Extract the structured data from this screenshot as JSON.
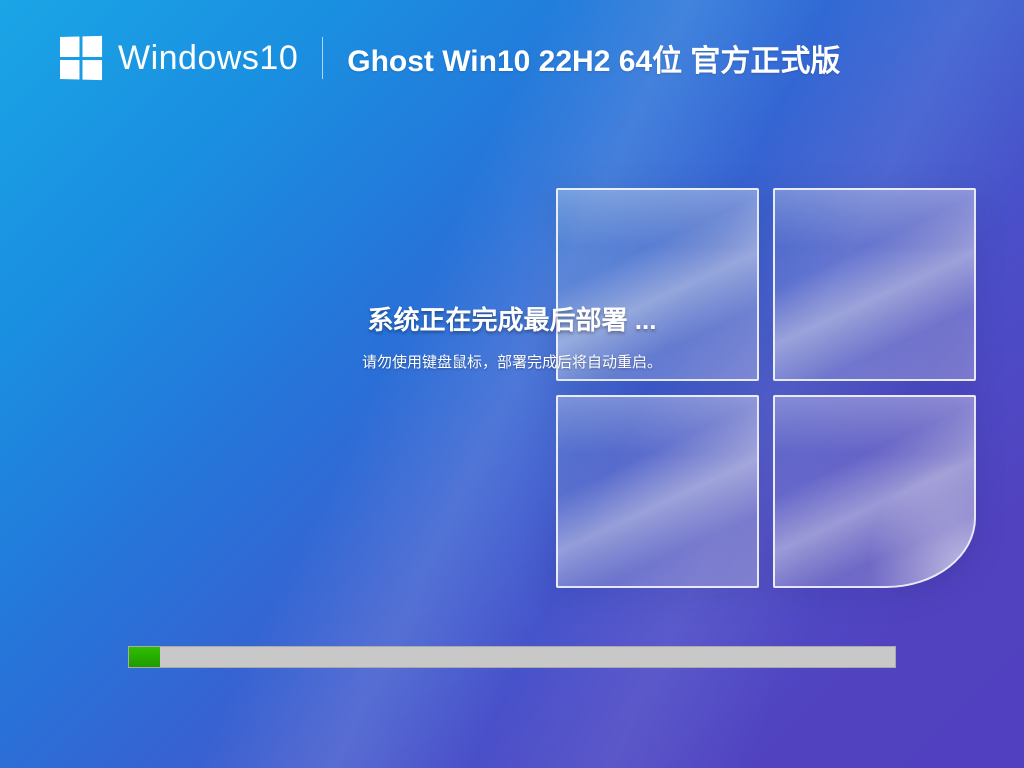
{
  "header": {
    "brand": "Windows10",
    "title": "Ghost Win10 22H2 64位 官方正式版"
  },
  "messages": {
    "main": "系统正在完成最后部署 ...",
    "sub": "请勿使用键盘鼠标，部署完成后将自动重启。"
  },
  "progress": {
    "percent": 4
  },
  "colors": {
    "progress_fill": "#22ad00",
    "progress_track": "#c8c8c8"
  }
}
